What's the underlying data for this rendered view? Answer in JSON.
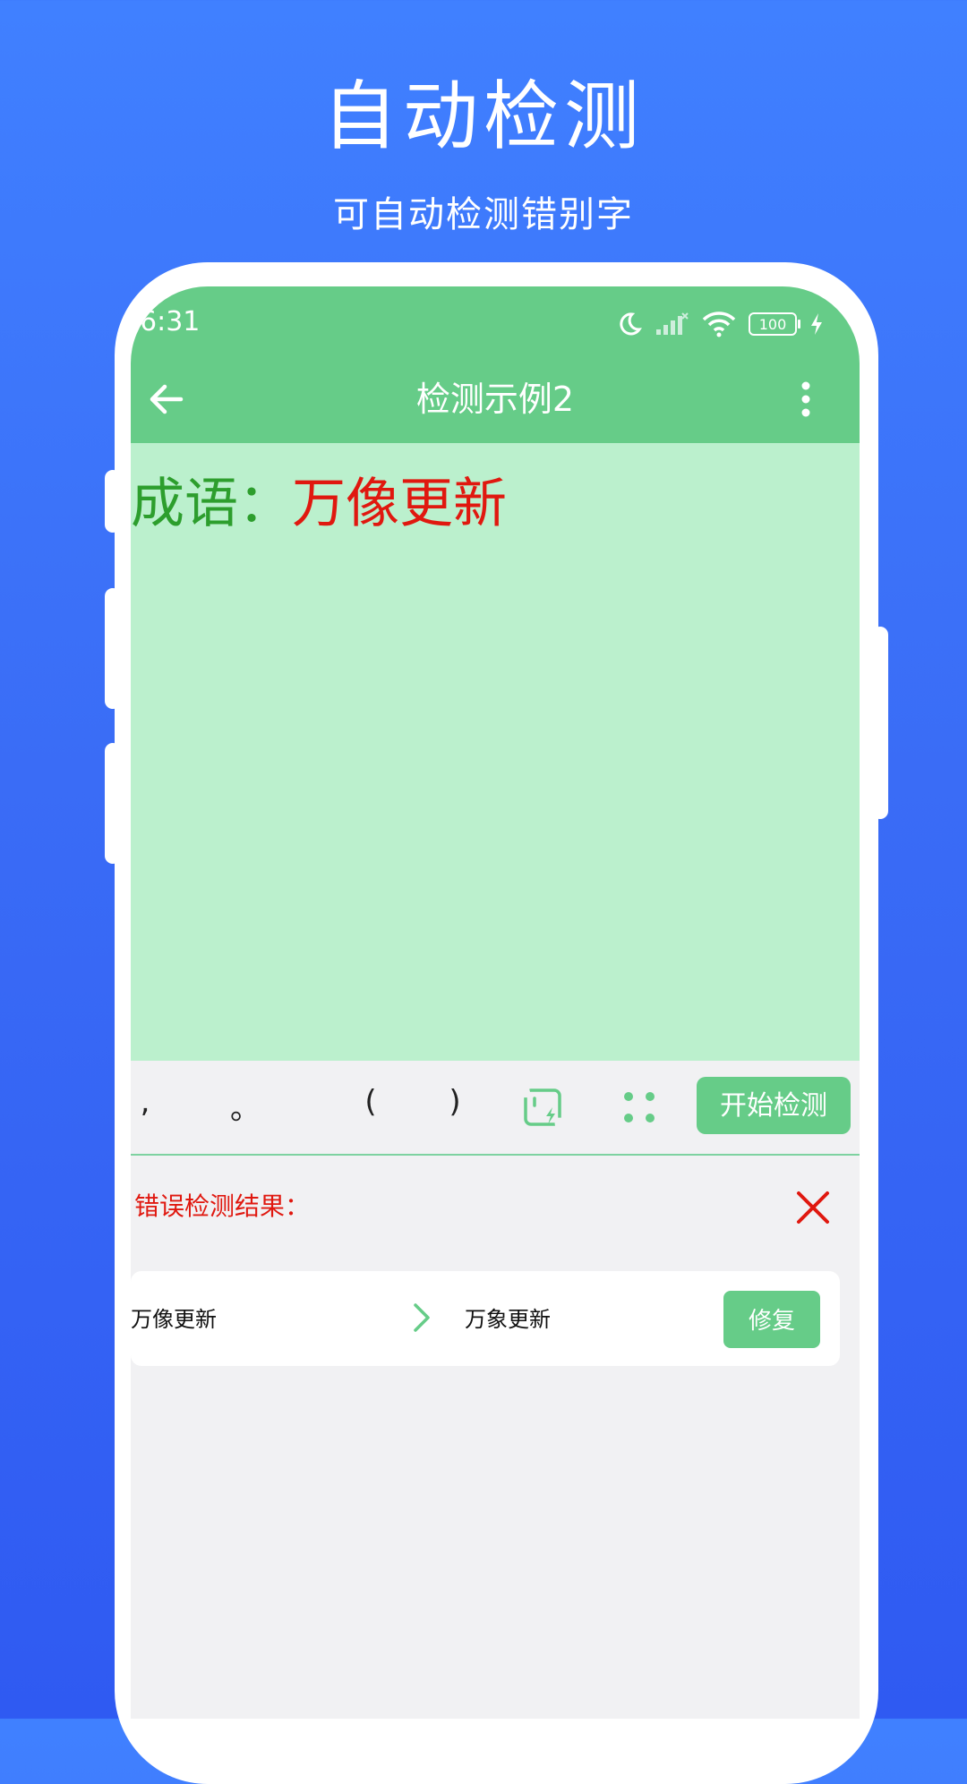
{
  "promo": {
    "title": "自动检测",
    "subtitle": "可自动检测错别字"
  },
  "status_bar": {
    "time": "6:31",
    "battery": "100"
  },
  "app_bar": {
    "title": "检测示例2"
  },
  "editor": {
    "label": "成语：",
    "value": "万像更新"
  },
  "toolbar": {
    "keys": [
      ",",
      "。",
      "(",
      ")"
    ],
    "start_button": "开始检测"
  },
  "results": {
    "title": "错误检测结果：",
    "items": [
      {
        "wrong": "万像更新",
        "correct": "万象更新",
        "fix_label": "修复"
      }
    ]
  },
  "colors": {
    "accent_green": "#66cc88",
    "editor_bg": "#bbf0cd",
    "error_red": "#e0180f",
    "promo_blue": "#3a6cf6"
  }
}
